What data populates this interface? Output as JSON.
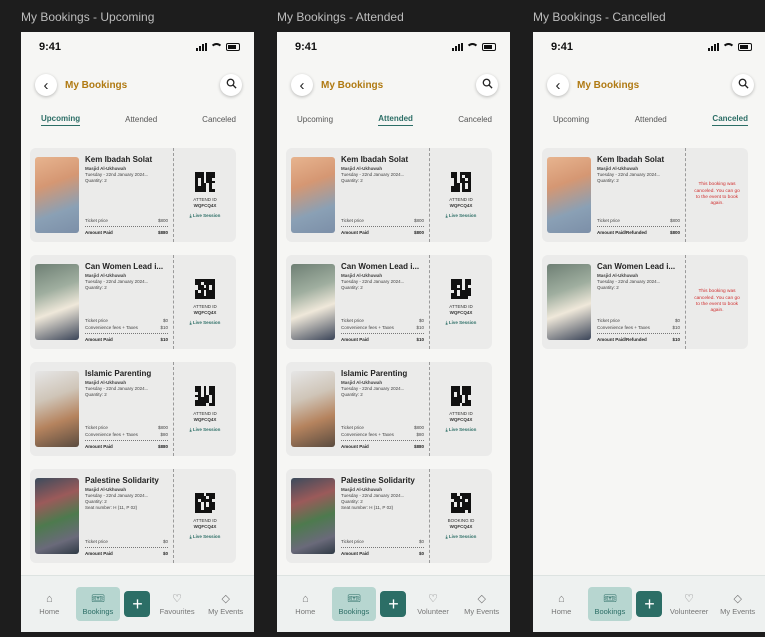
{
  "frames": [
    {
      "frame_title": "My Bookings - Upcoming",
      "status_time": "9:41",
      "header_title": "My Bookings",
      "tabs": [
        {
          "label": "Upcoming",
          "active": true
        },
        {
          "label": "Attended",
          "active": false
        },
        {
          "label": "Canceled",
          "active": false
        }
      ],
      "cards": [
        {
          "title": "Kem Ibadah Solat",
          "mosque": "Masjid Al-Ukhuwah",
          "date": "Tuesday - 22nd January 2024...",
          "quantity": "Quantity: 2",
          "seat": "",
          "rows": [
            {
              "label": "Ticket price",
              "value": "$800"
            }
          ],
          "paid_label": "Amount Paid",
          "paid_value": "$880",
          "side_type": "qr",
          "id_label": "ATTEND ID",
          "id_code": "WQFCQ4X",
          "live": "Live Session",
          "cancel_msg": "",
          "img": "prayer"
        },
        {
          "title": "Can Women Lead i...",
          "mosque": "Masjid Al-Ukhuwah",
          "date": "Tuesday - 22nd January 2024...",
          "quantity": "Quantity: 2",
          "seat": "",
          "rows": [
            {
              "label": "Ticket price",
              "value": "$0"
            },
            {
              "label": "Convenience fees + Taxes",
              "value": "$10"
            }
          ],
          "paid_label": "Amount Paid",
          "paid_value": "$10",
          "side_type": "qr",
          "id_label": "ATTEND ID",
          "id_code": "WQFCQ4X",
          "live": "Live Session",
          "cancel_msg": "",
          "img": "woman"
        },
        {
          "title": "Islamic Parenting",
          "mosque": "Masjid Al-Ukhuwah",
          "date": "Tuesday - 22nd January 2024...",
          "quantity": "Quantity: 2",
          "seat": "",
          "rows": [
            {
              "label": "Ticket price",
              "value": "$800"
            },
            {
              "label": "Convenience fees + Taxes",
              "value": "$80"
            }
          ],
          "paid_label": "Amount Paid",
          "paid_value": "$880",
          "side_type": "qr",
          "id_label": "ATTEND ID",
          "id_code": "WQFCQ4X",
          "live": "Live Session",
          "cancel_msg": "",
          "img": "family"
        },
        {
          "title": "Palestine Solidarity",
          "mosque": "Masjid Al-Ukhuwah",
          "date": "Tuesday - 22nd January 2024...",
          "quantity": "Quantity: 2",
          "seat": "Seat number: H (11, P 02)",
          "rows": [
            {
              "label": "Ticket price",
              "value": "$0"
            }
          ],
          "paid_label": "Amount Paid",
          "paid_value": "$0",
          "side_type": "qr",
          "id_label": "ATTEND ID",
          "id_code": "WQFCQ4X",
          "live": "Live Session",
          "cancel_msg": "",
          "img": "crowd"
        }
      ],
      "nav": [
        {
          "label": "Home",
          "icon": "home-icon",
          "glyph": "⌂",
          "active": false
        },
        {
          "label": "Bookings",
          "icon": "ticket-icon",
          "glyph": "🎟",
          "active": true
        },
        {
          "label": "",
          "icon": "plus-icon",
          "glyph": "+",
          "active": false,
          "plus": true
        },
        {
          "label": "Favourites",
          "icon": "heart-icon",
          "glyph": "♡",
          "active": false
        },
        {
          "label": "My Events",
          "icon": "tag-icon",
          "glyph": "◇",
          "active": false
        }
      ]
    },
    {
      "frame_title": "My Bookings - Attended",
      "status_time": "9:41",
      "header_title": "My Bookings",
      "tabs": [
        {
          "label": "Upcoming",
          "active": false
        },
        {
          "label": "Attended",
          "active": true
        },
        {
          "label": "Canceled",
          "active": false
        }
      ],
      "cards": [
        {
          "title": "Kem Ibadah Solat",
          "mosque": "Masjid Al-Ukhuwah",
          "date": "Tuesday - 22nd January 2024...",
          "quantity": "Quantity: 2",
          "seat": "",
          "rows": [
            {
              "label": "Ticket price",
              "value": "$800"
            }
          ],
          "paid_label": "Amount Paid",
          "paid_value": "$800",
          "side_type": "qr",
          "id_label": "ATTEND ID",
          "id_code": "WQFCQ4X",
          "live": "Live Session",
          "cancel_msg": "",
          "img": "prayer"
        },
        {
          "title": "Can Women Lead i...",
          "mosque": "Masjid Al-Ukhuwah",
          "date": "Tuesday - 22nd January 2024...",
          "quantity": "Quantity: 2",
          "seat": "",
          "rows": [
            {
              "label": "Ticket price",
              "value": "$0"
            },
            {
              "label": "Convenience fees + Taxes",
              "value": "$10"
            }
          ],
          "paid_label": "Amount Paid",
          "paid_value": "$10",
          "side_type": "qr",
          "id_label": "ATTEND ID",
          "id_code": "WQFCQ4X",
          "live": "Live Session",
          "cancel_msg": "",
          "img": "woman"
        },
        {
          "title": "Islamic Parenting",
          "mosque": "Masjid Al-Ukhuwah",
          "date": "Tuesday - 22nd January 2024...",
          "quantity": "Quantity: 2",
          "seat": "",
          "rows": [
            {
              "label": "Ticket price",
              "value": "$800"
            },
            {
              "label": "Convenience fees + Taxes",
              "value": "$80"
            }
          ],
          "paid_label": "Amount Paid",
          "paid_value": "$880",
          "side_type": "qr",
          "id_label": "ATTEND ID",
          "id_code": "WQFCQ4X",
          "live": "Live Session",
          "cancel_msg": "",
          "img": "family"
        },
        {
          "title": "Palestine Solidarity",
          "mosque": "Masjid Al-Ukhuwah",
          "date": "Tuesday - 22nd January 2024...",
          "quantity": "Quantity: 2",
          "seat": "Seat number: H (11, P 02)",
          "rows": [
            {
              "label": "Ticket price",
              "value": "$0"
            }
          ],
          "paid_label": "Amount Paid",
          "paid_value": "$0",
          "side_type": "qr",
          "id_label": "BOOKING ID",
          "id_code": "WQFCQ4X",
          "live": "Live Session",
          "cancel_msg": "",
          "img": "crowd"
        }
      ],
      "nav": [
        {
          "label": "Home",
          "icon": "home-icon",
          "glyph": "⌂",
          "active": false
        },
        {
          "label": "Bookings",
          "icon": "ticket-icon",
          "glyph": "🎟",
          "active": true
        },
        {
          "label": "",
          "icon": "plus-icon",
          "glyph": "+",
          "active": false,
          "plus": true
        },
        {
          "label": "Volunteer",
          "icon": "heart-icon",
          "glyph": "♡",
          "active": false
        },
        {
          "label": "My Events",
          "icon": "tag-icon",
          "glyph": "◇",
          "active": false
        }
      ]
    },
    {
      "frame_title": "My Bookings - Cancelled",
      "status_time": "9:41",
      "header_title": "My Bookings",
      "tabs": [
        {
          "label": "Upcoming",
          "active": false
        },
        {
          "label": "Attended",
          "active": false
        },
        {
          "label": "Canceled",
          "active": true
        }
      ],
      "cards": [
        {
          "title": "Kem Ibadah Solat",
          "mosque": "Masjid Al-Ukhuwah",
          "date": "Tuesday - 22nd January 2024...",
          "quantity": "Quantity: 2",
          "seat": "",
          "rows": [
            {
              "label": "Ticket price",
              "value": "$800"
            }
          ],
          "paid_label": "Amount Paid/Refunded",
          "paid_value": "$800",
          "side_type": "cancel",
          "id_label": "",
          "id_code": "",
          "live": "",
          "cancel_msg": "This booking was canceled. You can go to the event to book again.",
          "img": "prayer"
        },
        {
          "title": "Can Women Lead i...",
          "mosque": "Masjid Al-Ukhuwah",
          "date": "Tuesday - 22nd January 2024...",
          "quantity": "Quantity: 2",
          "seat": "",
          "rows": [
            {
              "label": "Ticket price",
              "value": "$0"
            },
            {
              "label": "Convenience fees + Taxes",
              "value": "$10"
            }
          ],
          "paid_label": "Amount Paid/Refunded",
          "paid_value": "$10",
          "side_type": "cancel",
          "id_label": "",
          "id_code": "",
          "live": "",
          "cancel_msg": "This booking was canceled. You can go to the event to book again.",
          "img": "woman"
        }
      ],
      "nav": [
        {
          "label": "Home",
          "icon": "home-icon",
          "glyph": "⌂",
          "active": false
        },
        {
          "label": "Bookings",
          "icon": "ticket-icon",
          "glyph": "🎟",
          "active": true
        },
        {
          "label": "",
          "icon": "plus-icon",
          "glyph": "+",
          "active": false,
          "plus": true
        },
        {
          "label": "Volunteerer",
          "icon": "heart-icon",
          "glyph": "♡",
          "active": false
        },
        {
          "label": "My Events",
          "icon": "tag-icon",
          "glyph": "◇",
          "active": false
        }
      ]
    }
  ],
  "colors": {
    "accent": "#2c6e66",
    "title_gold": "#b07a12",
    "cancel_red": "#d03030",
    "nav_active_bg": "#b7d6d0"
  }
}
